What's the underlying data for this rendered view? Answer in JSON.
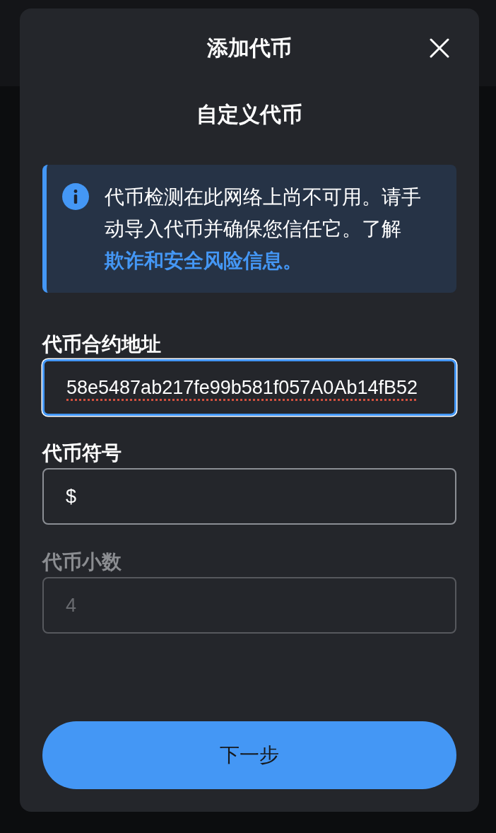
{
  "dialog": {
    "title": "添加代币",
    "subtitle": "自定义代币"
  },
  "notice": {
    "text": "代币检测在此网络上尚不可用。请手动导入代币并确保您信任它。了解",
    "link": "欺诈和安全风险信息。"
  },
  "fields": [
    {
      "label": "代币合约地址",
      "value": "58e5487ab217fe99b581f057A0Ab14fB52",
      "focused": true,
      "disabled": false,
      "spell_error": true
    },
    {
      "label": "代币符号",
      "value": "$",
      "focused": false,
      "disabled": false,
      "spell_error": false
    },
    {
      "label": "代币小数",
      "value": "4",
      "focused": false,
      "disabled": true,
      "spell_error": false
    }
  ],
  "primary_button": {
    "label": "下一步"
  }
}
